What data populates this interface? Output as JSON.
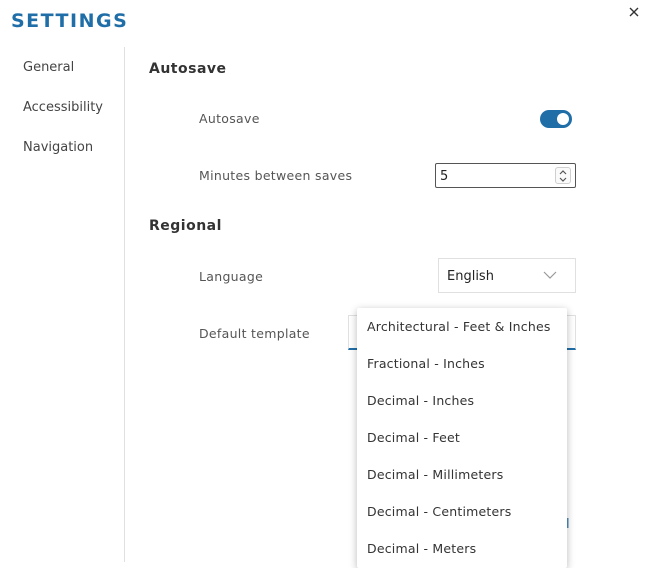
{
  "header": {
    "title": "SETTINGS",
    "close_icon": "close-icon"
  },
  "sidebar": {
    "items": [
      {
        "label": "General"
      },
      {
        "label": "Accessibility"
      },
      {
        "label": "Navigation"
      }
    ]
  },
  "autosave": {
    "title": "Autosave",
    "toggle_label": "Autosave",
    "toggle_on": true,
    "minutes_label": "Minutes between saves",
    "minutes_value": "5"
  },
  "regional": {
    "title": "Regional",
    "language_label": "Language",
    "language_value": "English",
    "template_label": "Default template",
    "template_options": [
      "Architectural - Feet & Inches",
      "Fractional - Inches",
      "Decimal - Inches",
      "Decimal - Feet",
      "Decimal - Millimeters",
      "Decimal - Centimeters",
      "Decimal - Meters"
    ]
  },
  "colors": {
    "accent": "#1f6ea8",
    "text": "#333333",
    "border": "#e0e0e0"
  }
}
